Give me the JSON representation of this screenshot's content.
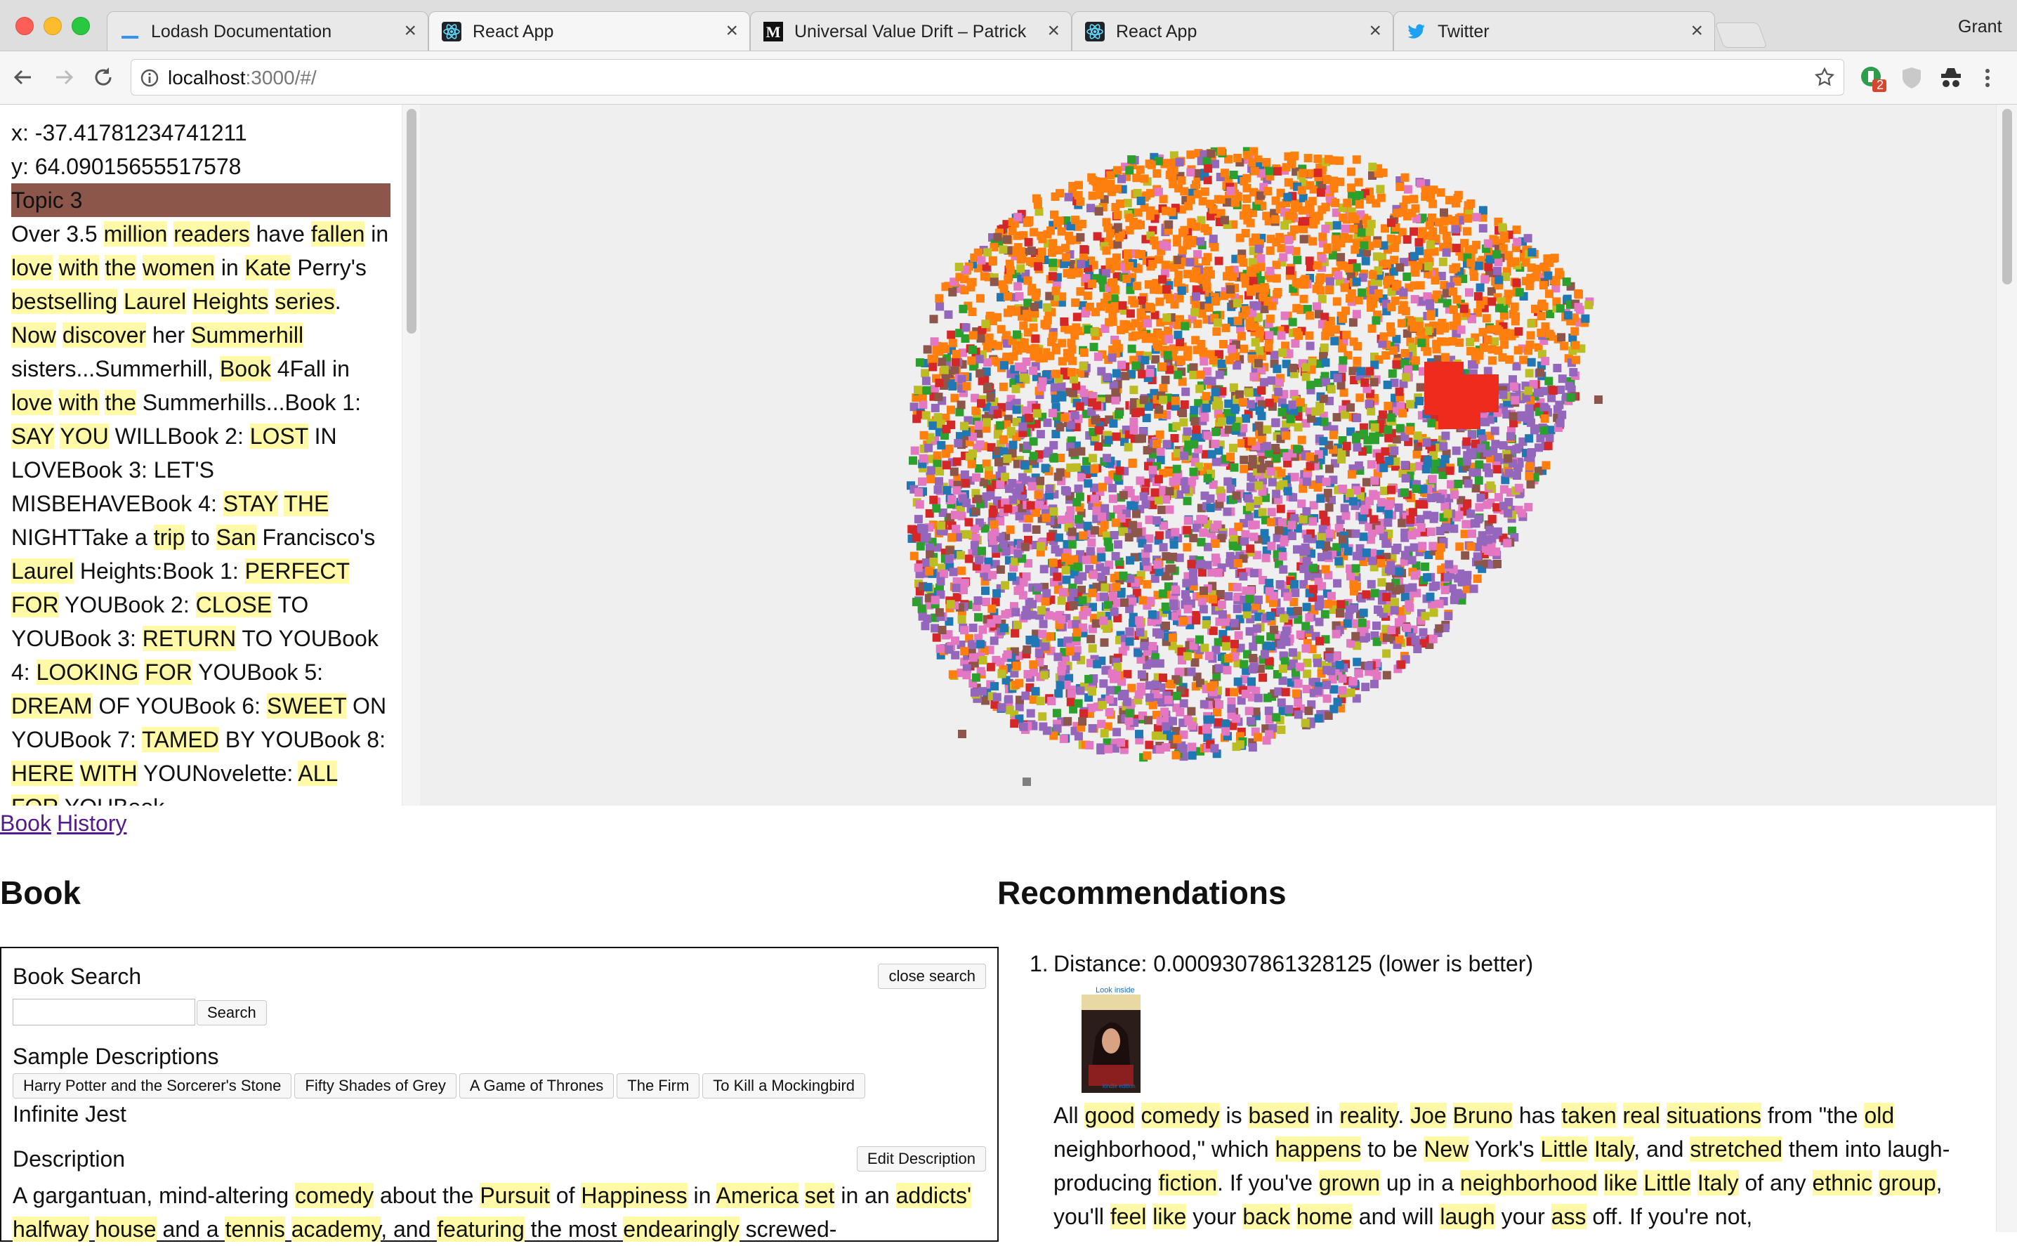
{
  "browser": {
    "tabs": [
      {
        "label": "Lodash Documentation",
        "icon": "lodash-icon",
        "active": false
      },
      {
        "label": "React App",
        "icon": "react-icon",
        "active": true
      },
      {
        "label": "Universal Value Drift – Patrick",
        "icon": "medium-icon",
        "active": false
      },
      {
        "label": "React App",
        "icon": "react-icon",
        "active": false
      },
      {
        "label": "Twitter",
        "icon": "twitter-icon",
        "active": false
      }
    ],
    "profile_name": "Grant",
    "url_host": "localhost",
    "url_path": ":3000/#/",
    "extension_badge": "2"
  },
  "hover": {
    "x_text": "x: -37.41781234741211",
    "y_text": "y: 64.09015655517578",
    "topic": "Topic 3",
    "topic_color": "#8c564b",
    "description_segments": [
      {
        "t": "Over 3.5 "
      },
      {
        "t": "million",
        "h": 1
      },
      {
        "t": " "
      },
      {
        "t": "readers",
        "h": 1
      },
      {
        "t": " have "
      },
      {
        "t": "fallen",
        "h": 1
      },
      {
        "t": " in "
      },
      {
        "t": "love",
        "h": 1
      },
      {
        "t": " "
      },
      {
        "t": "with",
        "h": 1
      },
      {
        "t": " "
      },
      {
        "t": "the",
        "h": 1
      },
      {
        "t": " "
      },
      {
        "t": "women",
        "h": 1
      },
      {
        "t": " in "
      },
      {
        "t": "Kate",
        "h": 1
      },
      {
        "t": " Perry's "
      },
      {
        "t": "bestselling",
        "h": 1
      },
      {
        "t": " "
      },
      {
        "t": "Laurel",
        "h": 1
      },
      {
        "t": " "
      },
      {
        "t": "Heights",
        "h": 1
      },
      {
        "t": " "
      },
      {
        "t": "series",
        "h": 1
      },
      {
        "t": ". "
      },
      {
        "t": "Now",
        "h": 1
      },
      {
        "t": " "
      },
      {
        "t": "discover",
        "h": 1
      },
      {
        "t": " her "
      },
      {
        "t": "Summerhill",
        "h": 1
      },
      {
        "t": " sisters...Summerhill, "
      },
      {
        "t": "Book",
        "h": 1
      },
      {
        "t": " 4Fall in "
      },
      {
        "t": "love",
        "h": 1
      },
      {
        "t": " "
      },
      {
        "t": "with",
        "h": 1
      },
      {
        "t": " "
      },
      {
        "t": "the",
        "h": 1
      },
      {
        "t": " Summerhills...Book 1: "
      },
      {
        "t": "SAY",
        "h": 1
      },
      {
        "t": " "
      },
      {
        "t": "YOU",
        "h": 1
      },
      {
        "t": " WILLBook 2: "
      },
      {
        "t": "LOST",
        "h": 1
      },
      {
        "t": " IN LOVEBook 3: LET'S MISBEHAVEBook 4: "
      },
      {
        "t": "STAY",
        "h": 1
      },
      {
        "t": " "
      },
      {
        "t": "THE",
        "h": 1
      },
      {
        "t": " NIGHTTake a "
      },
      {
        "t": "trip",
        "h": 1
      },
      {
        "t": " to "
      },
      {
        "t": "San",
        "h": 1
      },
      {
        "t": " Francisco's "
      },
      {
        "t": "Laurel",
        "h": 1
      },
      {
        "t": " Heights:Book 1: "
      },
      {
        "t": "PERFECT",
        "h": 1
      },
      {
        "t": " "
      },
      {
        "t": "FOR",
        "h": 1
      },
      {
        "t": " YOUBook 2: "
      },
      {
        "t": "CLOSE",
        "h": 1
      },
      {
        "t": " TO YOUBook 3: "
      },
      {
        "t": "RETURN",
        "h": 1
      },
      {
        "t": " TO YOUBook 4: "
      },
      {
        "t": "LOOKING",
        "h": 1
      },
      {
        "t": " "
      },
      {
        "t": "FOR",
        "h": 1
      },
      {
        "t": " YOUBook 5: "
      },
      {
        "t": "DREAM",
        "h": 1
      },
      {
        "t": " OF YOUBook 6: "
      },
      {
        "t": "SWEET",
        "h": 1
      },
      {
        "t": " ON YOUBook 7: "
      },
      {
        "t": "TAMED",
        "h": 1
      },
      {
        "t": " BY YOUBook 8: "
      },
      {
        "t": "HERE",
        "h": 1
      },
      {
        "t": " "
      },
      {
        "t": "WITH",
        "h": 1
      },
      {
        "t": " YOUNovelette: "
      },
      {
        "t": "ALL",
        "h": 1
      },
      {
        "t": " "
      },
      {
        "t": "FOR",
        "h": 1
      },
      {
        "t": " YOUBook"
      }
    ]
  },
  "scatter": {
    "topic_colors": [
      "#ff7f0e",
      "#9467bd",
      "#e377c2",
      "#d62728",
      "#1f77b4",
      "#2ca02c",
      "#8c564b",
      "#bcbd22",
      "#17becf",
      "#7f7f7f"
    ],
    "selected_color": "#ee2b1d"
  },
  "nav_links": [
    "Book",
    "History"
  ],
  "book": {
    "heading": "Book",
    "search_title": "Book Search",
    "close_search": "close search",
    "search_button": "Search",
    "search_value": "",
    "samples_title": "Sample Descriptions",
    "samples": [
      "Harry Potter and the Sorcerer's Stone",
      "Fifty Shades of Grey",
      "A Game of Thrones",
      "The Firm",
      "To Kill a Mockingbird"
    ],
    "selected_title": "Infinite Jest",
    "description_title": "Description",
    "edit_button": "Edit Description",
    "description_segments": [
      {
        "t": "A gargantuan, mind-altering "
      },
      {
        "t": "comedy",
        "h": 1
      },
      {
        "t": " about the "
      },
      {
        "t": "Pursuit",
        "h": 1
      },
      {
        "t": " of "
      },
      {
        "t": "Happiness",
        "h": 1
      },
      {
        "t": " in "
      },
      {
        "t": "America",
        "h": 1
      },
      {
        "t": " "
      },
      {
        "t": "set",
        "h": 1
      },
      {
        "t": " in an "
      },
      {
        "t": "addicts'",
        "h": 1
      },
      {
        "t": " "
      },
      {
        "t": "halfway",
        "h": 1
      },
      {
        "t": " "
      },
      {
        "t": "house",
        "h": 1
      },
      {
        "t": " and a "
      },
      {
        "t": "tennis",
        "h": 1
      },
      {
        "t": " "
      },
      {
        "t": "academy",
        "h": 1
      },
      {
        "t": ", and "
      },
      {
        "t": "featuring",
        "h": 1
      },
      {
        "t": " the most "
      },
      {
        "t": "endearingly",
        "h": 1
      },
      {
        "t": " screwed-"
      }
    ]
  },
  "recommendations": {
    "heading": "Recommendations",
    "items": [
      {
        "number": "1.",
        "distance": "Distance: 0.0009307861328125 (lower is better)",
        "cover_caption": "Look inside",
        "cover_badge": "kindle edition",
        "text_segments": [
          {
            "t": "All "
          },
          {
            "t": "good",
            "h": 1
          },
          {
            "t": " "
          },
          {
            "t": "comedy",
            "h": 1
          },
          {
            "t": " is "
          },
          {
            "t": "based",
            "h": 1
          },
          {
            "t": " in "
          },
          {
            "t": "reality",
            "h": 1
          },
          {
            "t": ". "
          },
          {
            "t": "Joe",
            "h": 1
          },
          {
            "t": " "
          },
          {
            "t": "Bruno",
            "h": 1
          },
          {
            "t": " has "
          },
          {
            "t": "taken",
            "h": 1
          },
          {
            "t": " "
          },
          {
            "t": "real",
            "h": 1
          },
          {
            "t": " "
          },
          {
            "t": "situations",
            "h": 1
          },
          {
            "t": " from \"the "
          },
          {
            "t": "old",
            "h": 1
          },
          {
            "t": " neighborhood,\" which "
          },
          {
            "t": "happens",
            "h": 1
          },
          {
            "t": " to be "
          },
          {
            "t": "New",
            "h": 1
          },
          {
            "t": " York's "
          },
          {
            "t": "Little",
            "h": 1
          },
          {
            "t": " "
          },
          {
            "t": "Italy",
            "h": 1
          },
          {
            "t": ", and "
          },
          {
            "t": "stretched",
            "h": 1
          },
          {
            "t": " them into laugh-producing "
          },
          {
            "t": "fiction",
            "h": 1
          },
          {
            "t": ". If you've "
          },
          {
            "t": "grown",
            "h": 1
          },
          {
            "t": " up in a "
          },
          {
            "t": "neighborhood",
            "h": 1
          },
          {
            "t": " "
          },
          {
            "t": "like",
            "h": 1
          },
          {
            "t": " "
          },
          {
            "t": "Little",
            "h": 1
          },
          {
            "t": " "
          },
          {
            "t": "Italy",
            "h": 1
          },
          {
            "t": " of any "
          },
          {
            "t": "ethnic",
            "h": 1
          },
          {
            "t": " "
          },
          {
            "t": "group",
            "h": 1
          },
          {
            "t": ", you'll "
          },
          {
            "t": "feel",
            "h": 1
          },
          {
            "t": " "
          },
          {
            "t": "like",
            "h": 1
          },
          {
            "t": " your "
          },
          {
            "t": "back",
            "h": 1
          },
          {
            "t": " "
          },
          {
            "t": "home",
            "h": 1
          },
          {
            "t": " and will "
          },
          {
            "t": "laugh",
            "h": 1
          },
          {
            "t": " your "
          },
          {
            "t": "ass",
            "h": 1
          },
          {
            "t": " off.  If you're not,"
          }
        ]
      }
    ]
  }
}
